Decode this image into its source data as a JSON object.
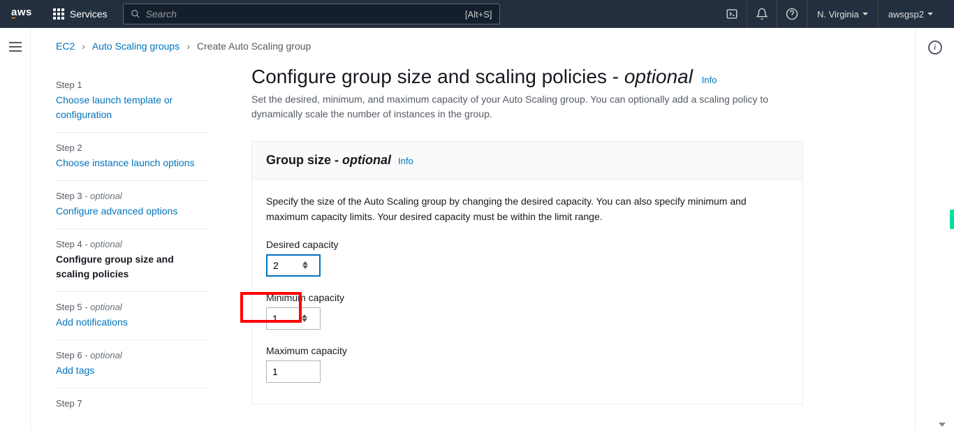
{
  "nav": {
    "logo_text": "aws",
    "services_label": "Services",
    "search_placeholder": "Search",
    "search_shortcut": "[Alt+S]",
    "region": "N. Virginia",
    "account": "awsgsp2"
  },
  "breadcrumb": {
    "items": [
      "EC2",
      "Auto Scaling groups",
      "Create Auto Scaling group"
    ]
  },
  "steps": [
    {
      "label": "Step 1",
      "optional": false,
      "title": "Choose launch template or configuration",
      "current": false
    },
    {
      "label": "Step 2",
      "optional": false,
      "title": "Choose instance launch options",
      "current": false
    },
    {
      "label": "Step 3",
      "optional": true,
      "title": "Configure advanced options",
      "current": false
    },
    {
      "label": "Step 4",
      "optional": true,
      "title": "Configure group size and scaling policies",
      "current": true
    },
    {
      "label": "Step 5",
      "optional": true,
      "title": "Add notifications",
      "current": false
    },
    {
      "label": "Step 6",
      "optional": true,
      "title": "Add tags",
      "current": false
    },
    {
      "label": "Step 7",
      "optional": false,
      "title": "",
      "current": false
    }
  ],
  "page": {
    "title_main": "Configure group size and scaling policies - ",
    "title_optional": "optional",
    "info_link": "Info",
    "description": "Set the desired, minimum, and maximum capacity of your Auto Scaling group. You can optionally add a scaling policy to dynamically scale the number of instances in the group."
  },
  "card": {
    "title_main": "Group size - ",
    "title_optional": "optional",
    "info_link": "Info",
    "description": "Specify the size of the Auto Scaling group by changing the desired capacity. You can also specify minimum and maximum capacity limits. Your desired capacity must be within the limit range.",
    "fields": {
      "desired_label": "Desired capacity",
      "desired_value": "2",
      "minimum_label": "Minimum capacity",
      "minimum_value": "1",
      "maximum_label": "Maximum capacity",
      "maximum_value": "1"
    }
  },
  "optional_text": " - optional"
}
